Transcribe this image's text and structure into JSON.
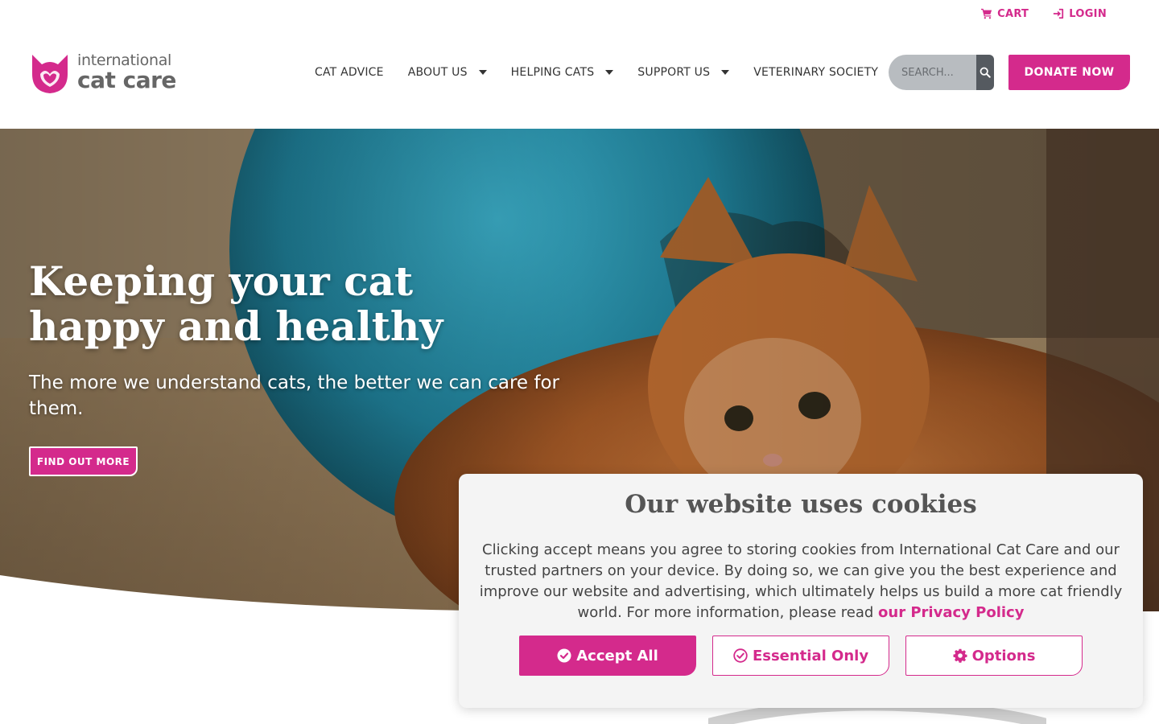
{
  "utility": {
    "cart": "CART",
    "login": "LOGIN"
  },
  "logo": {
    "line1": "international",
    "line2": "cat care"
  },
  "nav": {
    "items": [
      {
        "label": "CAT ADVICE",
        "dropdown": false
      },
      {
        "label": "ABOUT US",
        "dropdown": true
      },
      {
        "label": "HELPING CATS",
        "dropdown": true
      },
      {
        "label": "SUPPORT US",
        "dropdown": true
      },
      {
        "label": "VETERINARY SOCIETY",
        "dropdown": true
      }
    ]
  },
  "search": {
    "placeholder": "SEARCH...",
    "icon": "search-icon"
  },
  "donate": {
    "label": "DONATE NOW"
  },
  "hero": {
    "title": "Keeping your cat happy and healthy",
    "subtitle": "The more we understand cats, the better we can care for them.",
    "button": "FIND OUT MORE"
  },
  "cookie": {
    "title": "Our website uses cookies",
    "text": "Clicking accept means you agree to storing cookies from International Cat Care and our trusted partners on your device. By doing so, we can give you the best experience and improve our website and advertising, which ultimately helps us build a more cat friendly world. For more information, please read ",
    "link": "our Privacy Policy",
    "accept": "Accept All",
    "essential": "Essential Only",
    "options": "Options"
  },
  "colors": {
    "brand": "#d42a8c",
    "gray": "#666666"
  }
}
